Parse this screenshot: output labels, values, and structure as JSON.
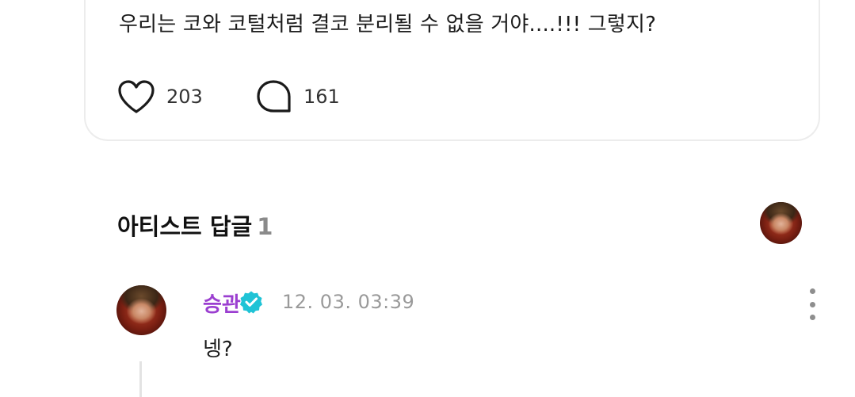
{
  "post": {
    "text": "우리는 코와 코털처럼 결코 분리될 수 없을 거야....!!! 그렇지?",
    "like_count": "203",
    "comment_count": "161"
  },
  "artist_reply": {
    "section_title": "아티스트 답글",
    "count": "1",
    "author": "승관",
    "timestamp": "12. 03. 03:39",
    "text": "넹?"
  },
  "colors": {
    "author": "#9b3fd0",
    "verified_badge": "#1fc3d6",
    "muted": "#9a9a9a"
  }
}
